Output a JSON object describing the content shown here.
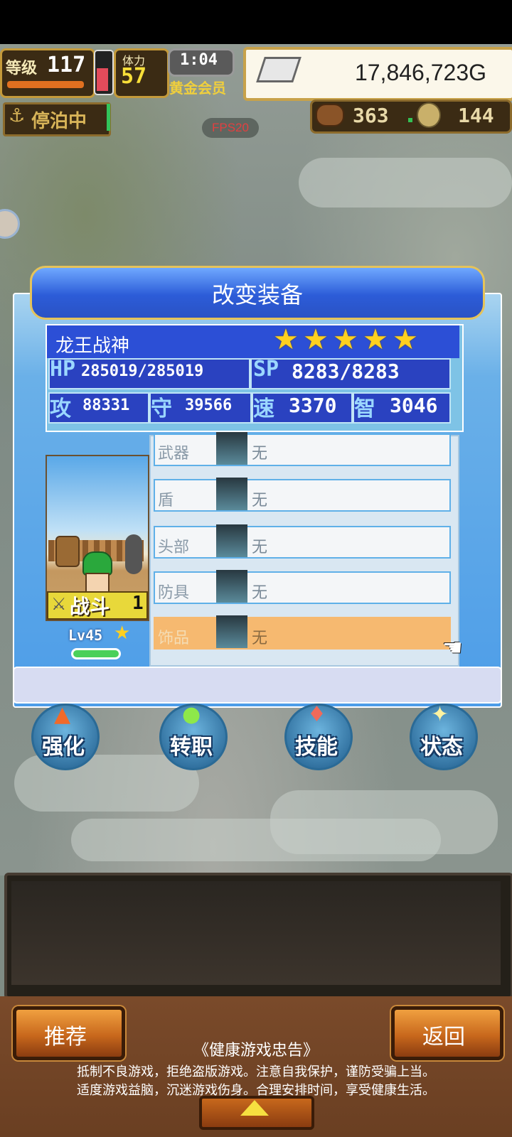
{
  "hud": {
    "level_label": "等级",
    "level_value": "117",
    "stamina_label": "体力",
    "stamina_value": "57",
    "time": "1:04",
    "member_label": "黄金会员",
    "gold": "17,846,723G",
    "anchor_label": "停泊中",
    "fps": "FPS20",
    "food_value": "363",
    "coin_value": "144"
  },
  "panel": {
    "title": "改变装备",
    "character_name": "龙王战神",
    "rarity_stars": 5,
    "star_glyph": "★",
    "stats": {
      "hp_label": "HP",
      "hp_value": "285019/285019",
      "sp_label": "SP",
      "sp_value": "8283/8283",
      "atk_label": "攻",
      "atk_value": "88331",
      "def_label": "守",
      "def_value": "39566",
      "spd_label": "速",
      "spd_value": "3370",
      "int_label": "智",
      "int_value": "3046"
    },
    "portrait": {
      "job_label": "战斗",
      "job_rank": "1",
      "level_text": "Lv45"
    },
    "lv_tag": "LV",
    "slots": [
      {
        "name": "武器",
        "value": "无"
      },
      {
        "name": "盾",
        "value": "无"
      },
      {
        "name": "头部",
        "value": "无"
      },
      {
        "name": "防具",
        "value": "无"
      },
      {
        "name": "饰品",
        "value": "无"
      }
    ],
    "selected_slot": 4
  },
  "actions": [
    {
      "label": "强化",
      "icon": "arrow-up-icon",
      "color": "#f06a2a"
    },
    {
      "label": "转职",
      "icon": "leaf-icon",
      "color": "#8ee84a"
    },
    {
      "label": "技能",
      "icon": "flame-icon",
      "color": "#f06a5a"
    },
    {
      "label": "状态",
      "icon": "sparkle-icon",
      "color": "#fff3a0"
    }
  ],
  "bottom": {
    "recommend_label": "推荐",
    "back_label": "返回",
    "notice_title": "《健康游戏忠告》",
    "notice_line1": "抵制不良游戏，拒绝盗版游戏。注意自我保护，谨防受骗上当。",
    "notice_line2": "适度游戏益脑，沉迷游戏伤身。合理安排时间，享受健康生活。"
  }
}
